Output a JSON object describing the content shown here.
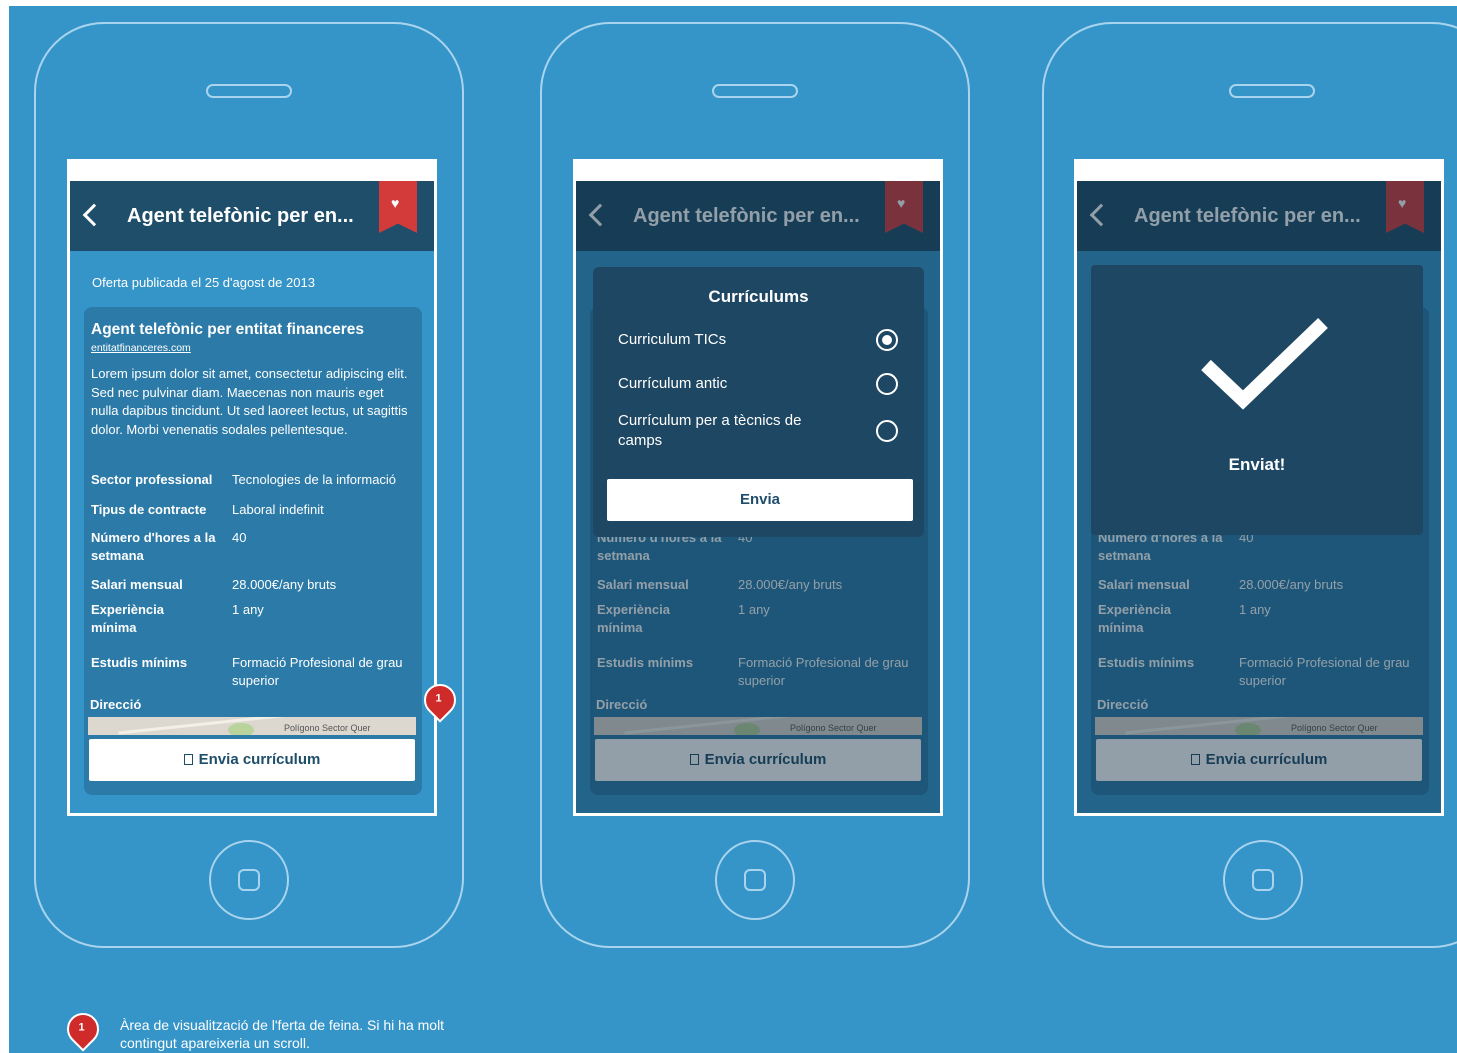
{
  "colors": {
    "background": "#3594c8",
    "appbar": "#1f4e6b",
    "bookmark": "#d33b3b",
    "marker": "#cf2b2b"
  },
  "job": {
    "appbar_title": "Agent telefònic per en...",
    "published": "Oferta publicada el 25 d'agost de 2013",
    "title": "Agent telefònic per entitat financeres",
    "link": "entitatfinanceres.com",
    "description": "Lorem ipsum dolor sit amet, consectetur adipiscing elit. Sed nec pulvinar diam. Maecenas non mauris eget nulla dapibus tincidunt. Ut sed laoreet lectus, ut sagittis dolor. Morbi venenatis sodales pellentesque.",
    "details": [
      {
        "label": "Sector professional",
        "value": "Tecnologies de la informació"
      },
      {
        "label": "Tipus de contracte",
        "value": "Laboral indefinit"
      },
      {
        "label": "Número d'hores a la setmana",
        "value": "40"
      },
      {
        "label": "Salari mensual",
        "value": "28.000€/any bruts"
      },
      {
        "label": "Experiència mínima",
        "value": "1 any"
      },
      {
        "label": "Estudis mínims",
        "value": "Formació Profesional de grau superior"
      }
    ],
    "address_label": "Direcció",
    "map_label": "Polígono Sector Quer",
    "send_cv_label": "Envia currículum"
  },
  "icons": {
    "back": "chevron-left-icon",
    "bookmark": "heart-icon",
    "send": "document-icon",
    "success": "check-icon"
  },
  "modal": {
    "title": "Currículums",
    "options": [
      {
        "label": "Curriculum TICs",
        "selected": true
      },
      {
        "label": "Currículum antic",
        "selected": false
      },
      {
        "label": "Currículum per a tècnics de camps",
        "selected": false
      }
    ],
    "submit_label": "Envia"
  },
  "success": {
    "message": "Enviat!"
  },
  "annotation": {
    "number": "1",
    "text": "Àrea de visualització de l'ferta de feina. Si hi ha molt contingut apareixeria un scroll."
  }
}
